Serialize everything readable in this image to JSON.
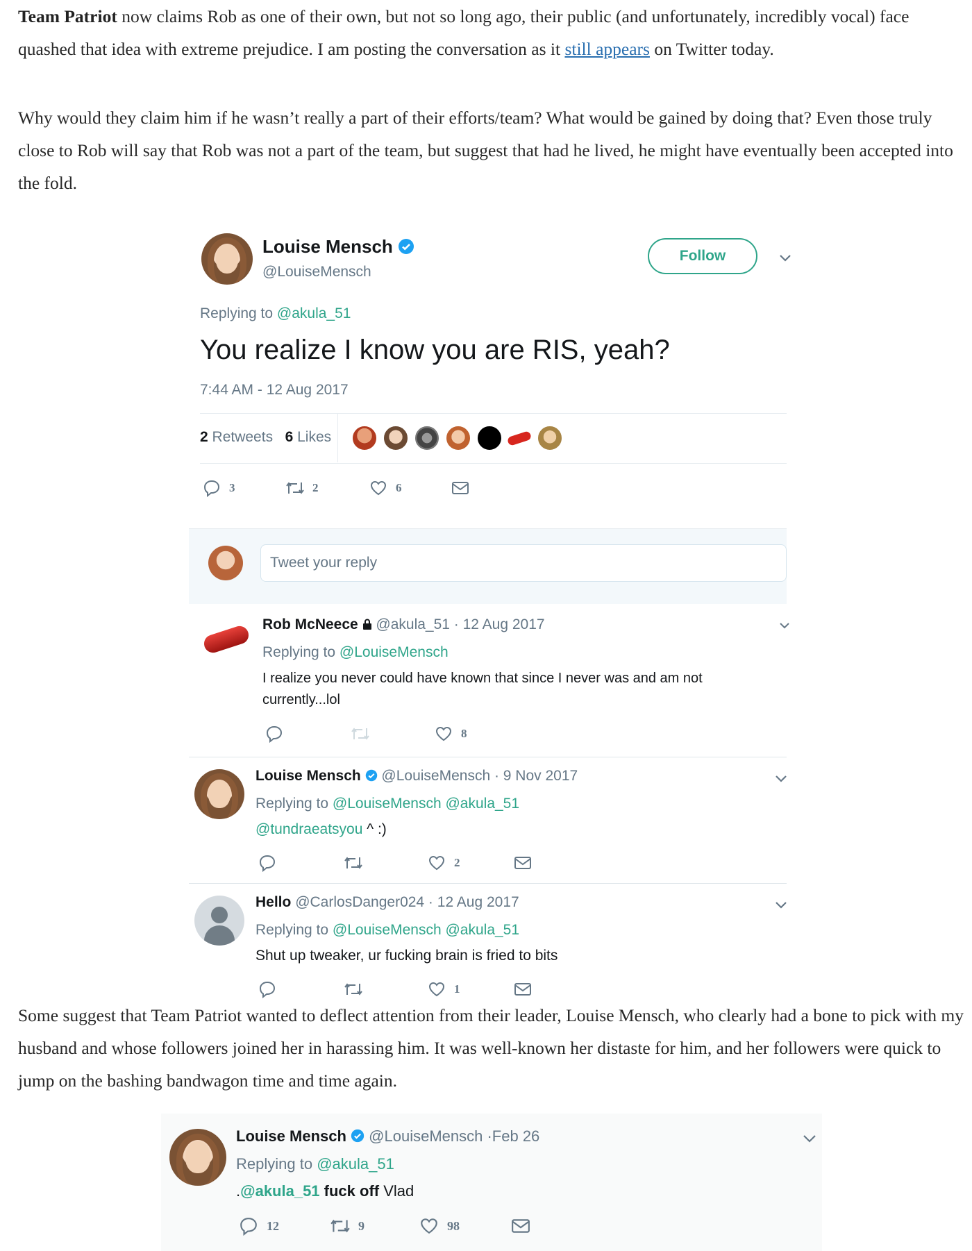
{
  "article": {
    "p1_bold": "Team Patriot",
    "p1_a": " now claims Rob as one of their own, but not so long ago, their public (and unfortunately, incredibly vocal) face quashed that idea with extreme prejudice. I am posting the conversation as it ",
    "p1_link": "still appears",
    "p1_b": " on Twitter today.",
    "p2": "Why would they claim him if he wasn’t really a part of their efforts/team? What would be gained by doing that? Even those truly close to Rob will say that Rob was not a part of the team, but suggest that had he lived, he might have eventually been accepted into the fold.",
    "p3": "Some suggest that Team Patriot wanted to deflect attention from their leader, Louise Mensch, who clearly had a bone to pick with my husband and whose followers joined her in harassing him. It was well-known her distaste for him, and her followers were quick to jump on the bashing bandwagon time and time again."
  },
  "main_tweet": {
    "name": "Louise Mensch",
    "handle": "@LouiseMensch",
    "follow_label": "Follow",
    "replying_prefix": "Replying to ",
    "replying_to": "@akula_51",
    "text": "You realize I know you are RIS, yeah?",
    "timestamp": "7:44 AM - 12 Aug 2017",
    "retweets_count": "2",
    "retweets_label": "Retweets",
    "likes_count": "6",
    "likes_label": "Likes",
    "reply_count": "3",
    "retweet_action_count": "2",
    "like_action_count": "6",
    "reply_placeholder": "Tweet your reply"
  },
  "replies": [
    {
      "name": "Rob McNeece",
      "handle_date": "@akula_51 · 12 Aug 2017",
      "replying_prefix": "Replying to ",
      "replying_to": "@LouiseMensch",
      "text": "I realize you never could have known that since I never was and am not currently...lol",
      "likes": "8"
    },
    {
      "name": "Louise Mensch",
      "handle_date": "@LouiseMensch · 9 Nov 2017",
      "replying_prefix": "Replying to ",
      "replying_to": "@LouiseMensch @akula_51",
      "mention": "@tundraeatsyou",
      "text": " ^ :)",
      "likes": "2"
    },
    {
      "name": "Hello",
      "handle_date": "@CarlosDanger024 · 12 Aug 2017",
      "replying_prefix": "Replying to ",
      "replying_to": "@LouiseMensch @akula_51",
      "text": "Shut up tweaker, ur fucking brain is fried to bits",
      "likes": "1"
    }
  ],
  "second_tweet": {
    "name": "Louise Mensch",
    "handle_date": "@LouiseMensch ·Feb 26",
    "replying_prefix": "Replying to ",
    "replying_to": "@akula_51",
    "text_prefix": ".",
    "mention": "@akula_51",
    "text_bold": " fuck off",
    "text_rest": " Vlad",
    "replies": "12",
    "retweets": "9",
    "likes": "98"
  },
  "colors": {
    "link": "#2a6fb0",
    "twitter_teal": "#2fa58a",
    "verified_blue": "#1da1f2",
    "muted": "#657786"
  }
}
